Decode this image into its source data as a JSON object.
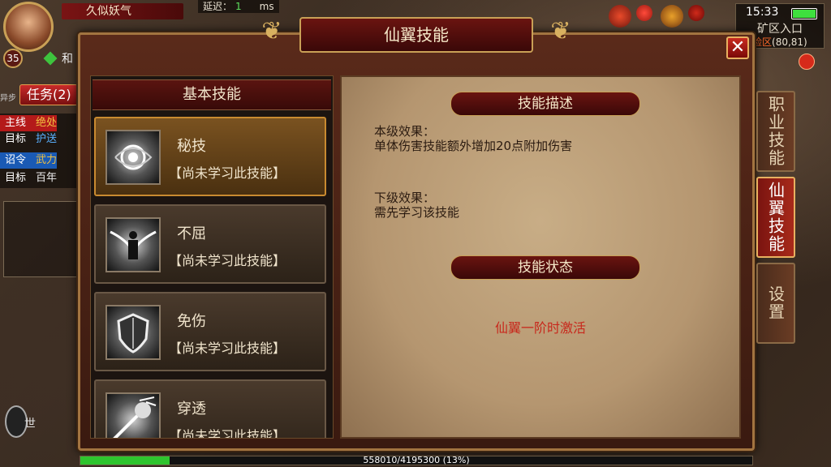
{
  "hud": {
    "player_name": "久似妖气",
    "level": "35",
    "latency_label": "延迟：",
    "latency_value": "1",
    "latency_unit": "ms",
    "status_char": "和",
    "task_button": "任务(2)",
    "side_label": "异步",
    "quests": [
      {
        "tag": "主线",
        "text": "绝处"
      },
      {
        "tag": "目标",
        "text": "护送",
        "sub": true
      },
      {
        "tag": "诏令",
        "text": "武力"
      },
      {
        "tag": "目标",
        "text": "百年"
      }
    ],
    "voice_label": "世",
    "clock": "15:33",
    "battery_level": 1.0,
    "map_name": "矿区入口",
    "map_coord_prefix": "险区",
    "map_coord": "(80,81)"
  },
  "dialog": {
    "title": "仙翼技能",
    "close_icon": "✕",
    "list_header": "基本技能",
    "skills": [
      {
        "name": "秘技",
        "status": "【尚未学习此技能】",
        "icon": "swirl-icon",
        "selected": true
      },
      {
        "name": "不屈",
        "status": "【尚未学习此技能】",
        "icon": "winged-figure-icon",
        "selected": false
      },
      {
        "name": "免伤",
        "status": "【尚未学习此技能】",
        "icon": "shield-icon",
        "selected": false
      },
      {
        "name": "穿透",
        "status": "【尚未学习此技能】",
        "icon": "piercing-fist-icon",
        "selected": false
      }
    ],
    "detail": {
      "desc_title": "技能描述",
      "current_label": "本级效果：",
      "current_text": "单体伤害技能额外增加20点附加伤害",
      "next_label": "下级效果：",
      "next_text": "需先学习该技能",
      "status_title": "技能状态",
      "activation": "仙翼一阶时激活"
    },
    "tabs": [
      {
        "label": "职业技能",
        "active": false
      },
      {
        "label": "仙翼技能",
        "active": true
      },
      {
        "label": "设置",
        "active": false
      }
    ]
  },
  "exp": {
    "text": "558010/4195300 (13%)",
    "fraction": 0.133
  },
  "colors": {
    "accent_red": "#c8281c",
    "gold": "#c9a056",
    "parchment": "#c8ad86",
    "exp_green": "#2ec42e"
  }
}
